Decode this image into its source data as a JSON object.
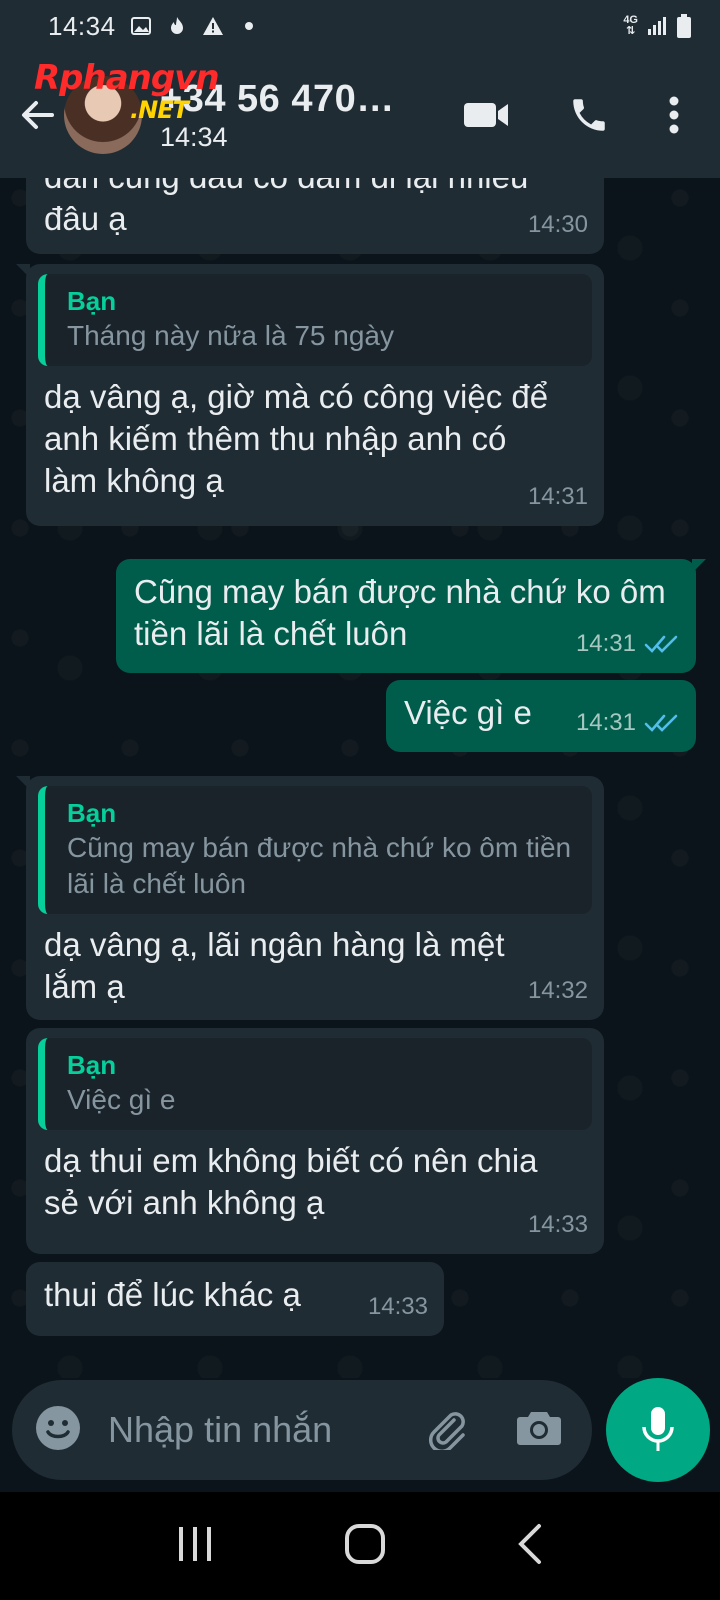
{
  "status_bar": {
    "time": "14:34",
    "network": "4G"
  },
  "header": {
    "contact_name": "+34 56 470…",
    "subtitle": "14:34",
    "watermark_main": "Rphangvn",
    "watermark_suffix": ".NET"
  },
  "messages": [
    {
      "dir": "in",
      "text": "đâu ạ",
      "partial_above": "dan cũng đâu có dám đi lại nhiều",
      "time": "14:30"
    },
    {
      "dir": "in",
      "quote_who": "Bạn",
      "quote_text": "Tháng này nữa là 75 ngày",
      "text": "dạ vâng ạ, giờ mà có công việc để anh kiếm thêm thu nhập anh có làm không ạ",
      "time": "14:31"
    },
    {
      "dir": "out",
      "text": "Cũng may bán được nhà chứ ko ôm tiền lãi là chết luôn",
      "time": "14:31"
    },
    {
      "dir": "out",
      "text": "Việc gì e",
      "time": "14:31"
    },
    {
      "dir": "in",
      "quote_who": "Bạn",
      "quote_text": "Cũng may bán được nhà chứ ko ôm tiền lãi là chết luôn",
      "text": "dạ vâng ạ, lãi ngân hàng là mệt lắm ạ",
      "time": "14:32"
    },
    {
      "dir": "in",
      "quote_who": "Bạn",
      "quote_text": "Việc gì e",
      "text": "dạ thui em không biết có nên chia sẻ với anh không ạ",
      "time": "14:33"
    },
    {
      "dir": "in",
      "text": "thui để lúc khác ạ",
      "time": "14:33"
    }
  ],
  "input": {
    "placeholder": "Nhập tin nhắn"
  },
  "colors": {
    "accent": "#00a884",
    "out_bubble": "#005c4b",
    "in_bubble": "#1f2c34",
    "read_tick": "#53bdeb"
  }
}
